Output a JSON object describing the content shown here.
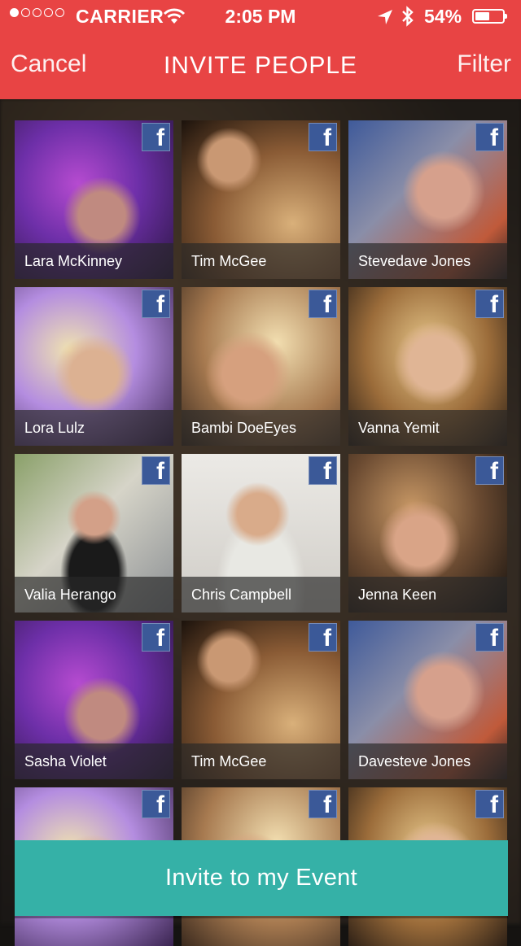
{
  "status_bar": {
    "carrier": "CARRIER",
    "time": "2:05 PM",
    "battery_percent": "54%",
    "battery_level": 0.54,
    "signal_bars_filled": 1,
    "signal_bars_total": 5,
    "icons": [
      "wifi-icon",
      "location-arrow-icon",
      "bluetooth-icon",
      "battery-icon"
    ]
  },
  "nav": {
    "cancel_label": "Cancel",
    "title": "INVITE PEOPLE",
    "filter_label": "Filter"
  },
  "colors": {
    "header": "#e84444",
    "accent_button": "#35b1a7",
    "facebook": "#3b5998",
    "selected_outline": "#3c5fa8"
  },
  "people": [
    {
      "name": "Lara McKinney",
      "source": "facebook",
      "selected": false
    },
    {
      "name": "Tim McGee",
      "source": "facebook",
      "selected": false
    },
    {
      "name": "Stevedave Jones",
      "source": "facebook",
      "selected": true
    },
    {
      "name": "Lora Lulz",
      "source": "facebook",
      "selected": false
    },
    {
      "name": "Bambi DoeEyes",
      "source": "facebook",
      "selected": false
    },
    {
      "name": "Vanna Yemit",
      "source": "facebook",
      "selected": false
    },
    {
      "name": "Valia Herango",
      "source": "facebook",
      "selected": false
    },
    {
      "name": "Chris Campbell",
      "source": "facebook",
      "selected": false
    },
    {
      "name": "Jenna Keen",
      "source": "facebook",
      "selected": false
    },
    {
      "name": "Sasha Violet",
      "source": "facebook",
      "selected": false
    },
    {
      "name": "Tim McGee",
      "source": "facebook",
      "selected": false
    },
    {
      "name": "Davesteve Jones",
      "source": "facebook",
      "selected": false
    },
    {
      "name": "",
      "source": "facebook",
      "selected": false
    },
    {
      "name": "",
      "source": "facebook",
      "selected": false
    },
    {
      "name": "",
      "source": "facebook",
      "selected": false
    }
  ],
  "facebook_glyph": "f",
  "invite_button_label": "Invite to my Event"
}
